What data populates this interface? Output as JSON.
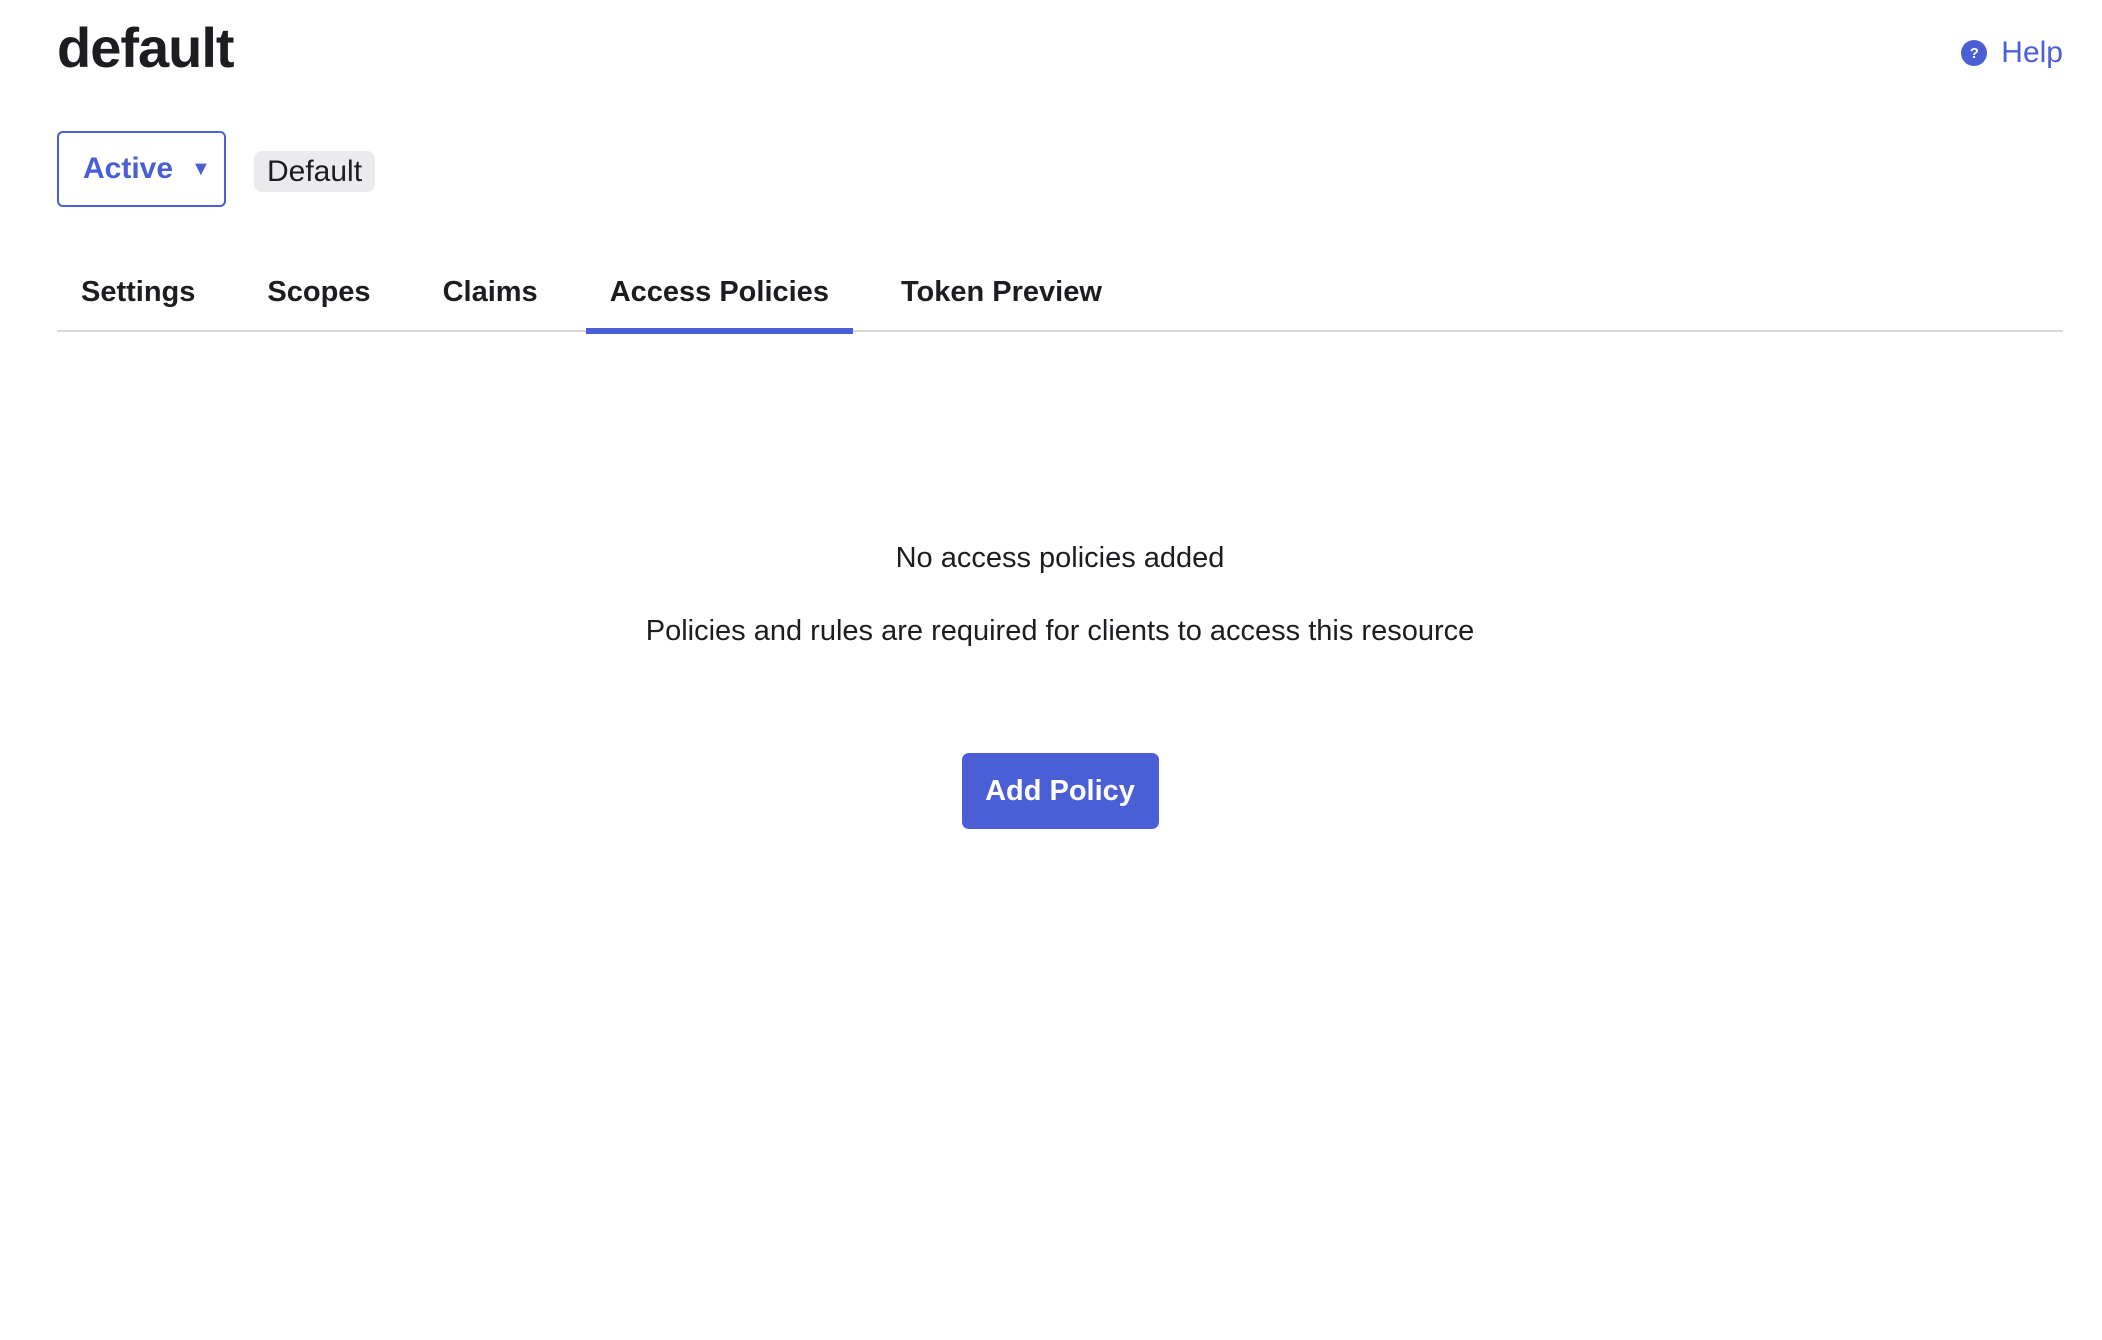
{
  "header": {
    "title": "default",
    "help_label": "Help",
    "help_icon": "help-circle-icon"
  },
  "status": {
    "selected": "Active",
    "caret_glyph": "▼",
    "badge": "Default"
  },
  "tabs": [
    {
      "label": "Settings",
      "active": false
    },
    {
      "label": "Scopes",
      "active": false
    },
    {
      "label": "Claims",
      "active": false
    },
    {
      "label": "Access Policies",
      "active": true
    },
    {
      "label": "Token Preview",
      "active": false
    }
  ],
  "empty_state": {
    "title": "No access policies added",
    "description": "Policies and rules are required for clients to access this resource",
    "action_label": "Add Policy"
  },
  "colors": {
    "accent": "#4a5fd6",
    "text": "#1d1d21",
    "badge_bg": "#ebebed",
    "divider": "#d7d7dc"
  }
}
